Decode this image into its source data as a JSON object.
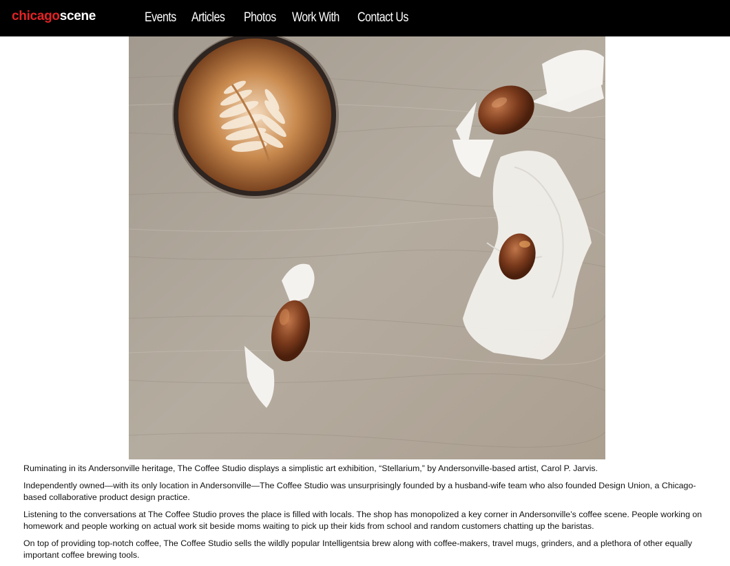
{
  "header": {
    "logo_part1": "chicago",
    "logo_part2": "scene",
    "nav": [
      "Events",
      "Articles",
      "Photos",
      "Work With",
      "Contact Us"
    ],
    "colors": {
      "background": "#000000",
      "logo_accent": "#e32326",
      "nav_text": "#ffffff"
    }
  },
  "hero_image": {
    "subject": "latte-and-caramels-photo"
  },
  "article": {
    "paragraphs": [
      "Ruminating in its Andersonville heritage, The Coffee Studio displays a simplistic art exhibition, “Stellarium,” by Andersonville-based artist, Carol P. Jarvis.",
      "Independently owned—with its only location in Andersonville—The Coffee Studio was unsurprisingly founded by a husband-wife team who also founded Design Union, a Chicago-based collaborative product design practice.",
      "Listening to the conversations at The Coffee Studio proves the place is filled with locals. The shop has monopolized a key corner in Andersonville’s coffee scene. People working on homework and people working on actual work sit beside moms waiting to pick up their kids from school and random customers chatting up the baristas.",
      "On top of providing top-notch coffee, The Coffee Studio sells the wildly popular Intelligentsia brew along with coffee-makers, travel mugs, grinders, and a plethora of other equally important coffee brewing tools."
    ]
  }
}
